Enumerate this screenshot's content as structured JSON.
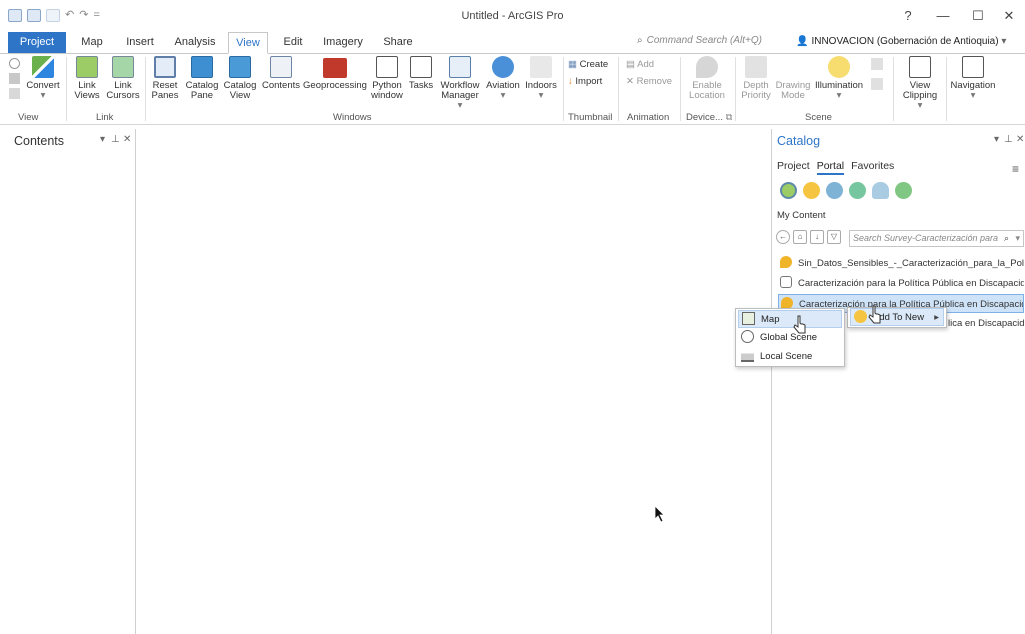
{
  "window": {
    "title": "Untitled - ArcGIS Pro",
    "help": "?",
    "minimize": "—",
    "maximize": "☐",
    "close": "✕"
  },
  "quick_access": {
    "undo": "↶",
    "redo": "↷",
    "more": "="
  },
  "tabs": [
    "Project",
    "Map",
    "Insert",
    "Analysis",
    "View",
    "Edit",
    "Imagery",
    "Share"
  ],
  "active_tab": "View",
  "command_search": {
    "placeholder": "Command Search (Alt+Q)"
  },
  "account": {
    "label": "INNOVACION (Gobernación de Antioquia)"
  },
  "ribbon": {
    "view_group": {
      "convert": "Convert",
      "label": "View"
    },
    "link_group": {
      "link_views": "Link Views",
      "link_cursors": "Link Cursors",
      "label": "Link"
    },
    "windows_group": {
      "reset_panes": "Reset Panes",
      "catalog_pane": "Catalog Pane",
      "catalog_view": "Catalog View",
      "contents": "Contents",
      "geoprocessing": "Geoprocessing",
      "python_window": "Python window",
      "tasks": "Tasks",
      "workflow_manager": "Workflow Manager",
      "aviation": "Aviation",
      "indoors": "Indoors",
      "label": "Windows"
    },
    "thumbnail_group": {
      "create": "Create",
      "import": "Import",
      "label": "Thumbnail"
    },
    "animation_group": {
      "add": "Add",
      "remove": "Remove",
      "label": "Animation"
    },
    "device_group": {
      "enable_location": "Enable Location",
      "label": "Device..."
    },
    "scene_group": {
      "depth_priority": "Depth Priority",
      "drawing_mode": "Drawing Mode",
      "illumination": "Illumination",
      "label": "Scene"
    },
    "view_clipping": "View Clipping",
    "navigation": "Navigation"
  },
  "contents_pane": {
    "title": "Contents"
  },
  "catalog_pane": {
    "title": "Catalog",
    "tabs": [
      "Project",
      "Portal",
      "Favorites"
    ],
    "active_tab": "Portal",
    "section": "My Content",
    "search_placeholder": "Search Survey-Caracterización para",
    "items": [
      "Sin_Datos_Sensibles_-_Caracterización_para_la_Politic",
      "Caracterización para la Política Pública en Discapacid",
      "Caracterización para la Política Pública en Discapacid",
      "lica en Discapacid"
    ]
  },
  "context_menu": {
    "add_to_new": "Add To New",
    "submenu": [
      "Map",
      "Global Scene",
      "Local Scene"
    ]
  },
  "colors": {
    "accent": "#2e75c8",
    "selection": "#cfe3f8"
  }
}
